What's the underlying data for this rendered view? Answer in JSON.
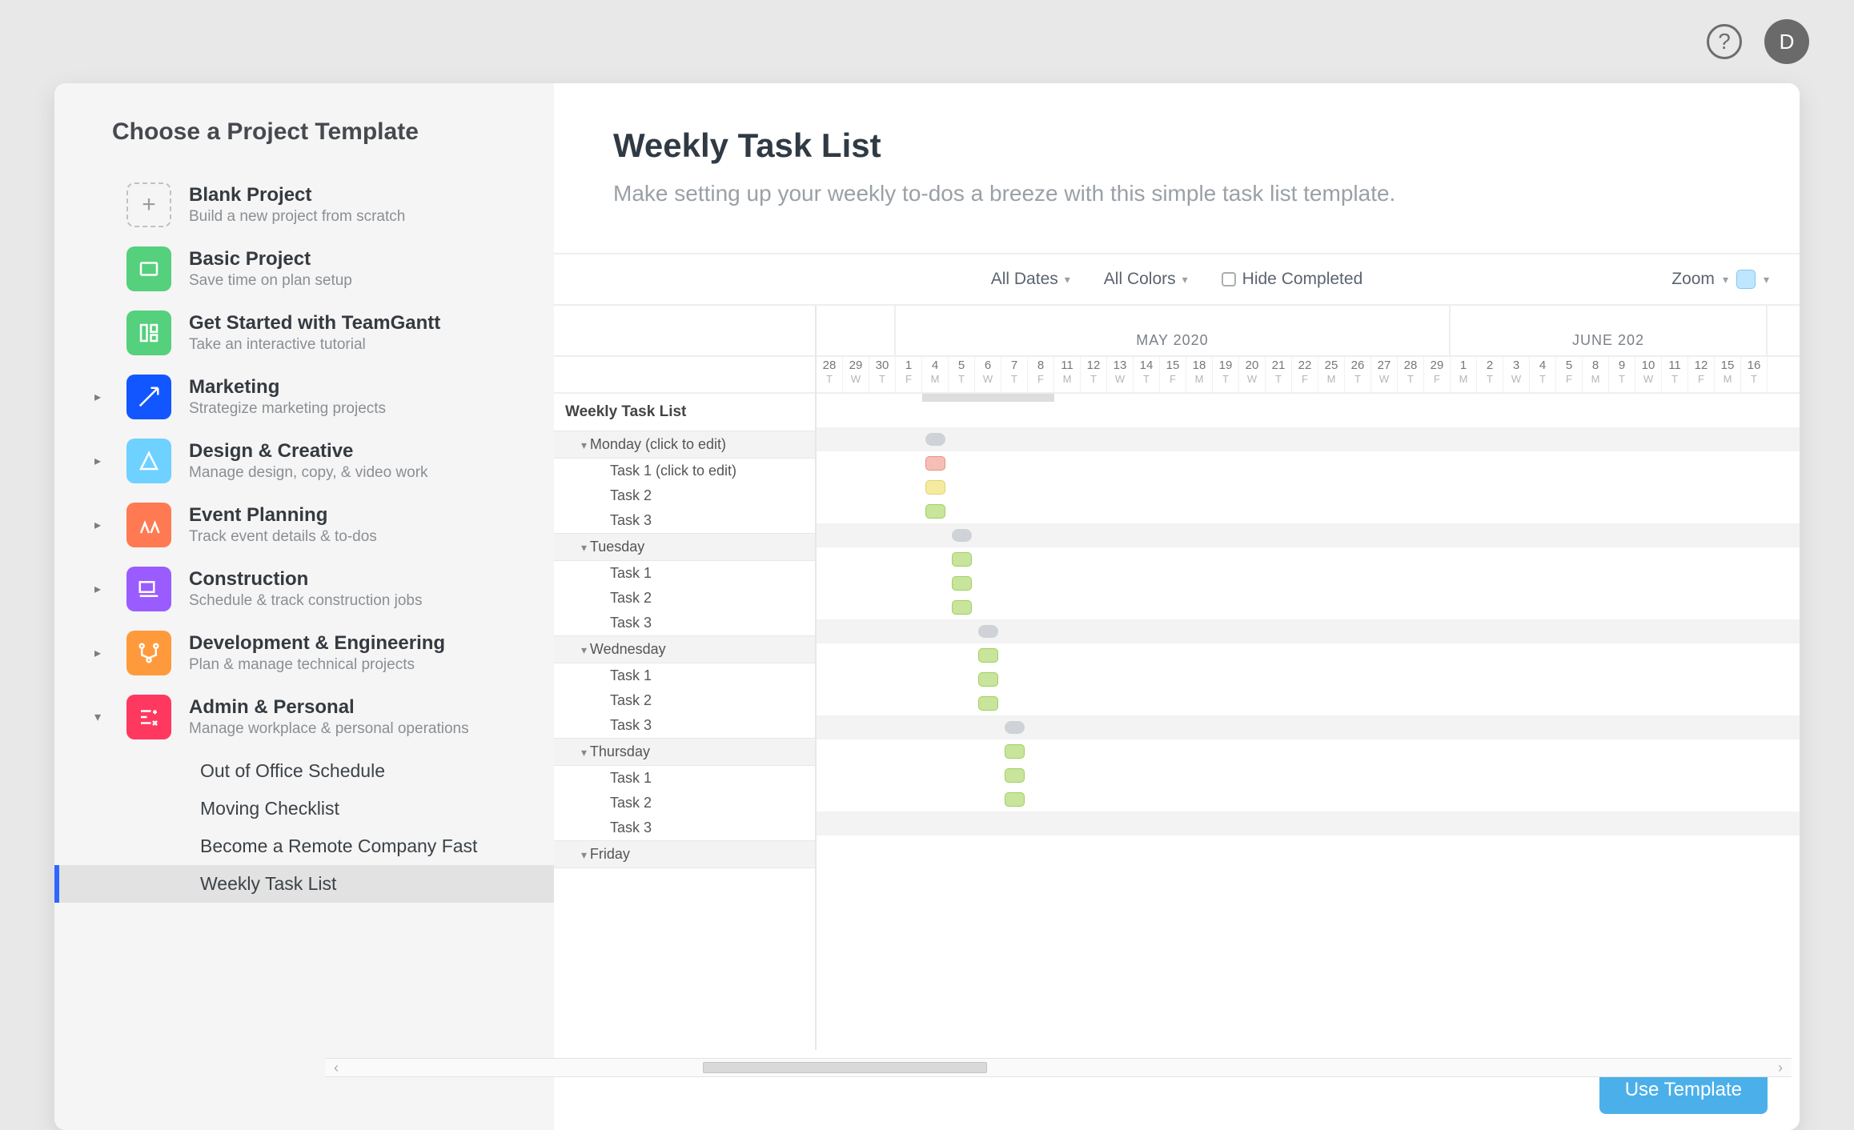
{
  "topbar": {
    "help_tooltip": "?",
    "avatar_initial": "D"
  },
  "sidebar": {
    "title": "Choose a Project Template",
    "categories": [
      {
        "name": "Blank Project",
        "sub": "Build a new project from scratch",
        "icon": "blank",
        "expandable": false
      },
      {
        "name": "Basic Project",
        "sub": "Save time on plan setup",
        "icon": "basic",
        "expandable": false
      },
      {
        "name": "Get Started with TeamGantt",
        "sub": "Take an interactive tutorial",
        "icon": "started",
        "expandable": false
      },
      {
        "name": "Marketing",
        "sub": "Strategize marketing projects",
        "icon": "market",
        "expandable": true
      },
      {
        "name": "Design & Creative",
        "sub": "Manage design, copy, & video work",
        "icon": "design",
        "expandable": true
      },
      {
        "name": "Event Planning",
        "sub": "Track event details & to-dos",
        "icon": "event",
        "expandable": true
      },
      {
        "name": "Construction",
        "sub": "Schedule & track construction jobs",
        "icon": "constr",
        "expandable": true
      },
      {
        "name": "Development & Engineering",
        "sub": "Plan & manage technical projects",
        "icon": "dev",
        "expandable": true
      },
      {
        "name": "Admin & Personal",
        "sub": "Manage workplace & personal operations",
        "icon": "admin",
        "expandable": true,
        "expanded": true,
        "children": [
          "Out of Office Schedule",
          "Moving Checklist",
          "Become a Remote Company Fast",
          "Weekly Task List"
        ],
        "selected_child": 3
      }
    ]
  },
  "main": {
    "title": "Weekly Task List",
    "description": "Make setting up your weekly to-dos a breeze with this simple task list template.",
    "toolbar": {
      "dates": "All Dates",
      "colors": "All Colors",
      "hide_completed": "Hide Completed",
      "zoom": "Zoom"
    },
    "timeline": {
      "months": [
        {
          "label": "",
          "days": 3
        },
        {
          "label": "MAY 2020",
          "days": 21
        },
        {
          "label": "JUNE 202",
          "days": 12
        }
      ],
      "days": [
        {
          "n": "28",
          "d": "T"
        },
        {
          "n": "29",
          "d": "W"
        },
        {
          "n": "30",
          "d": "T"
        },
        {
          "n": "1",
          "d": "F"
        },
        {
          "n": "4",
          "d": "M"
        },
        {
          "n": "5",
          "d": "T"
        },
        {
          "n": "6",
          "d": "W"
        },
        {
          "n": "7",
          "d": "T"
        },
        {
          "n": "8",
          "d": "F"
        },
        {
          "n": "11",
          "d": "M"
        },
        {
          "n": "12",
          "d": "T"
        },
        {
          "n": "13",
          "d": "W"
        },
        {
          "n": "14",
          "d": "T"
        },
        {
          "n": "15",
          "d": "F"
        },
        {
          "n": "18",
          "d": "M"
        },
        {
          "n": "19",
          "d": "T"
        },
        {
          "n": "20",
          "d": "W"
        },
        {
          "n": "21",
          "d": "T"
        },
        {
          "n": "22",
          "d": "F"
        },
        {
          "n": "25",
          "d": "M"
        },
        {
          "n": "26",
          "d": "T"
        },
        {
          "n": "27",
          "d": "W"
        },
        {
          "n": "28",
          "d": "T"
        },
        {
          "n": "29",
          "d": "F"
        },
        {
          "n": "1",
          "d": "M"
        },
        {
          "n": "2",
          "d": "T"
        },
        {
          "n": "3",
          "d": "W"
        },
        {
          "n": "4",
          "d": "T"
        },
        {
          "n": "5",
          "d": "F"
        },
        {
          "n": "8",
          "d": "M"
        },
        {
          "n": "9",
          "d": "T"
        },
        {
          "n": "10",
          "d": "W"
        },
        {
          "n": "11",
          "d": "T"
        },
        {
          "n": "12",
          "d": "F"
        },
        {
          "n": "15",
          "d": "M"
        },
        {
          "n": "16",
          "d": "T"
        }
      ],
      "left_title": "Weekly Task List",
      "groups": [
        {
          "name": "Monday (click to edit)",
          "tasks": [
            "Task 1 (click to edit)",
            "Task 2",
            "Task 3"
          ],
          "bars": [
            {
              "row": 0,
              "start": 4,
              "len": 1,
              "cls": "grey"
            },
            {
              "row": 1,
              "start": 4,
              "len": 1,
              "cls": "red"
            },
            {
              "row": 2,
              "start": 4,
              "len": 1,
              "cls": "yellow"
            },
            {
              "row": 3,
              "start": 4,
              "len": 1,
              "cls": "green"
            }
          ]
        },
        {
          "name": "Tuesday",
          "tasks": [
            "Task 1",
            "Task 2",
            "Task 3"
          ],
          "bars": [
            {
              "row": 0,
              "start": 5,
              "len": 1,
              "cls": "grey"
            },
            {
              "row": 1,
              "start": 5,
              "len": 1,
              "cls": "green"
            },
            {
              "row": 2,
              "start": 5,
              "len": 1,
              "cls": "green"
            },
            {
              "row": 3,
              "start": 5,
              "len": 1,
              "cls": "green"
            }
          ]
        },
        {
          "name": "Wednesday",
          "tasks": [
            "Task 1",
            "Task 2",
            "Task 3"
          ],
          "bars": [
            {
              "row": 0,
              "start": 6,
              "len": 1,
              "cls": "grey"
            },
            {
              "row": 1,
              "start": 6,
              "len": 1,
              "cls": "green"
            },
            {
              "row": 2,
              "start": 6,
              "len": 1,
              "cls": "green"
            },
            {
              "row": 3,
              "start": 6,
              "len": 1,
              "cls": "green"
            }
          ]
        },
        {
          "name": "Thursday",
          "tasks": [
            "Task 1",
            "Task 2",
            "Task 3"
          ],
          "bars": [
            {
              "row": 0,
              "start": 7,
              "len": 1,
              "cls": "grey"
            },
            {
              "row": 1,
              "start": 7,
              "len": 1,
              "cls": "green"
            },
            {
              "row": 2,
              "start": 7,
              "len": 1,
              "cls": "green"
            },
            {
              "row": 3,
              "start": 7,
              "len": 1,
              "cls": "green"
            }
          ]
        },
        {
          "name": "Friday",
          "tasks": [],
          "bars": []
        }
      ],
      "scrub": {
        "start": 4,
        "len": 5
      }
    },
    "use_button": "Use Template"
  }
}
